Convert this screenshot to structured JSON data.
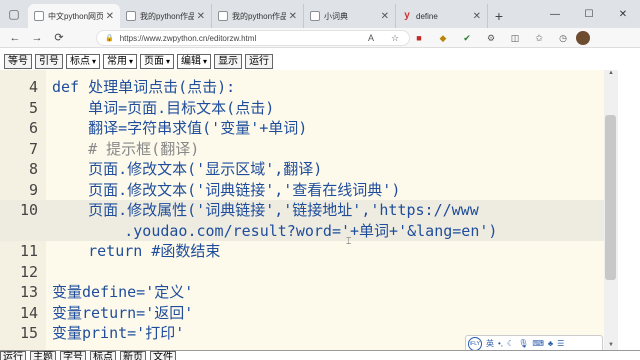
{
  "browser": {
    "tabs": [
      {
        "title": "中文python网页",
        "active": true,
        "icon": "page-icon"
      },
      {
        "title": "我的python作品",
        "active": false,
        "icon": "page-icon"
      },
      {
        "title": "我的python作品",
        "active": false,
        "icon": "page-icon"
      },
      {
        "title": "小词典",
        "active": false,
        "icon": "page-icon"
      },
      {
        "title": "define",
        "active": false,
        "icon": "y-logo-icon"
      }
    ],
    "url": "https://www.zwpython.cn/editorzw.html",
    "read_aloud": "A",
    "window_buttons": [
      "—",
      "☐",
      "✕"
    ]
  },
  "toolbar": {
    "buttons": [
      {
        "label": "等号",
        "type": "button"
      },
      {
        "label": "引号",
        "type": "button"
      },
      {
        "label": "标点",
        "type": "select"
      },
      {
        "label": "常用",
        "type": "select"
      },
      {
        "label": "页面",
        "type": "select"
      },
      {
        "label": "编辑",
        "type": "select"
      },
      {
        "label": "显示",
        "type": "button"
      },
      {
        "label": "运行",
        "type": "button"
      }
    ]
  },
  "editor": {
    "lines": [
      {
        "n": "4",
        "text": "def 处理单词点击(点击):"
      },
      {
        "n": "5",
        "text": "    单词=页面.目标文本(点击)"
      },
      {
        "n": "6",
        "text": "    翻译=字符串求值('变量'+单词)"
      },
      {
        "n": "7",
        "text": "    # 提示框(翻译)"
      },
      {
        "n": "8",
        "text": "    页面.修改文本('显示区域',翻译)"
      },
      {
        "n": "9",
        "text": "    页面.修改文本('词典链接','查看在线词典')"
      },
      {
        "n": "10",
        "text": "    页面.修改属性('词典链接','链接地址','https://www"
      },
      {
        "n": "",
        "text": "        .youdao.com/result?word='+单词+'&lang=en')"
      },
      {
        "n": "11",
        "text": "    return #函数结束"
      },
      {
        "n": "12",
        "text": ""
      },
      {
        "n": "13",
        "text": "变量define='定义'"
      },
      {
        "n": "14",
        "text": "变量return='返回'"
      },
      {
        "n": "15",
        "text": "变量print='打印'"
      }
    ]
  },
  "bottom": {
    "items": [
      "运行",
      "主题",
      "字号",
      "标点",
      "新页",
      "文件"
    ]
  },
  "ime": {
    "label": "英"
  }
}
